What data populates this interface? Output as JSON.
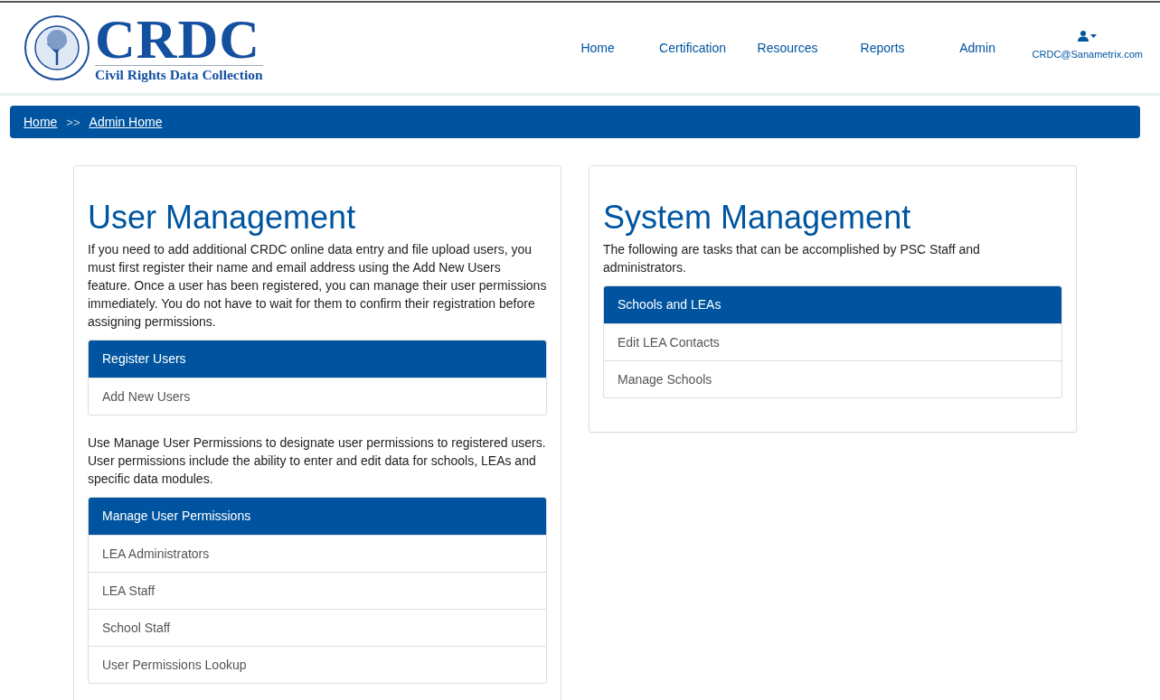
{
  "logo": {
    "title": "CRDC",
    "subtitle": "Civil Rights Data Collection"
  },
  "nav": [
    {
      "label": "Home"
    },
    {
      "label": "Certification"
    },
    {
      "label": "Resources"
    },
    {
      "label": "Reports"
    },
    {
      "label": "Admin"
    }
  ],
  "user": {
    "email": "CRDC@Sanametrix.com"
  },
  "breadcrumb": {
    "items": [
      "Home",
      "Admin Home"
    ],
    "separator": ">>"
  },
  "panels": [
    {
      "title": "User Management",
      "blocks": [
        {
          "kind": "text",
          "text": "If you need to add additional CRDC online data entry and file upload users, you must first register their name and email address using the Add New Users feature. Once a user has been registered, you can manage their user permissions immediately. You do not have to wait for them to confirm their registration before assigning permissions."
        },
        {
          "kind": "list",
          "heading": "Register Users",
          "items": [
            "Add New Users"
          ]
        },
        {
          "kind": "text",
          "text": "Use Manage User Permissions to designate user permissions to registered users. User permissions include the ability to enter and edit data for schools, LEAs and specific data modules."
        },
        {
          "kind": "list",
          "heading": "Manage User Permissions",
          "items": [
            "LEA Administrators",
            "LEA Staff",
            "School Staff",
            "User Permissions Lookup"
          ]
        }
      ]
    },
    {
      "title": "System Management",
      "blocks": [
        {
          "kind": "text",
          "text": "The following are tasks that can be accomplished by PSC Staff and administrators."
        },
        {
          "kind": "list",
          "heading": "Schools and LEAs",
          "items": [
            "Edit LEA Contacts",
            "Manage Schools"
          ]
        }
      ]
    }
  ]
}
